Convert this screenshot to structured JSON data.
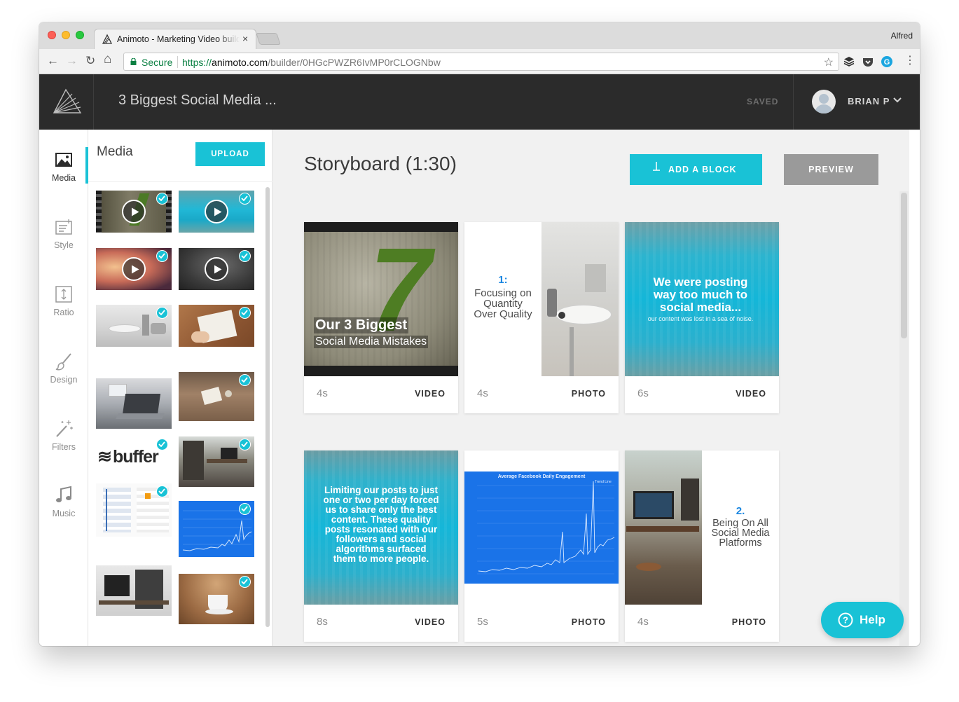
{
  "browser": {
    "tab_title": "Animoto - Marketing Video builder",
    "tab_close": "×",
    "profile_name": "Alfred",
    "secure_label": "Secure",
    "url_scheme": "https://",
    "url_host": "animoto.com",
    "url_path": "/builder/0HGcPWZR6IvMP0rCLOGNbw",
    "nav": {
      "back": "←",
      "forward": "→",
      "reload": "↻",
      "home": "⌂",
      "star": "☆",
      "menu": "⋮"
    }
  },
  "header": {
    "project_title": "3 Biggest Social Media ...",
    "save_status": "SAVED",
    "user_name": "BRIAN P"
  },
  "sidebar": {
    "items": [
      {
        "label": "Media",
        "icon": "image-icon",
        "active": true
      },
      {
        "label": "Style",
        "icon": "style-icon"
      },
      {
        "label": "Ratio",
        "icon": "ratio-icon"
      },
      {
        "label": "Design",
        "icon": "brush-icon"
      },
      {
        "label": "Filters",
        "icon": "magic-wand-icon"
      },
      {
        "label": "Music",
        "icon": "music-note-icon"
      }
    ]
  },
  "media_panel": {
    "title": "Media",
    "upload_label": "UPLOAD",
    "thumbnails": [
      {
        "kind": "video",
        "selected": true
      },
      {
        "kind": "video",
        "selected": true
      },
      {
        "kind": "video",
        "selected": true
      },
      {
        "kind": "video",
        "selected": true
      },
      {
        "kind": "photo",
        "selected": true
      },
      {
        "kind": "photo",
        "selected": true
      },
      {
        "kind": "photo",
        "selected": false
      },
      {
        "kind": "photo",
        "selected": true
      },
      {
        "kind": "logo",
        "logo_text": "buffer",
        "selected": true
      },
      {
        "kind": "photo",
        "selected": true
      },
      {
        "kind": "photo",
        "selected": true
      },
      {
        "kind": "chart",
        "selected": true
      },
      {
        "kind": "photo",
        "selected": false
      },
      {
        "kind": "photo",
        "selected": true
      }
    ]
  },
  "storyboard": {
    "title": "Storyboard (1:30)",
    "add_block_label": "ADD A BLOCK",
    "preview_label": "PREVIEW",
    "blocks": [
      {
        "duration": "4s",
        "type": "VIDEO",
        "heading": "Our 3 Biggest",
        "subheading": "Social Media Mistakes",
        "big_number": "7"
      },
      {
        "duration": "4s",
        "type": "PHOTO",
        "number": "1:",
        "lines": [
          "Focusing on",
          "Quantity",
          "Over Quality"
        ]
      },
      {
        "duration": "6s",
        "type": "VIDEO",
        "lines": [
          "We were posting",
          "way too much to",
          "social media..."
        ],
        "caption": "our content was lost in a sea of noise."
      },
      {
        "duration": "8s",
        "type": "VIDEO",
        "lines": [
          "Limiting our posts to just",
          "one or two per day forced",
          "us to share only the best",
          "content. These quality",
          "posts resonated with our",
          "followers and social",
          "algorithms surfaced",
          "them to more people."
        ]
      },
      {
        "duration": "5s",
        "type": "PHOTO",
        "chart_title": "Average Facebook Daily Engagement",
        "chart_corner": "Trend Line"
      },
      {
        "duration": "4s",
        "type": "PHOTO",
        "number": "2.",
        "lines": [
          "Being On All",
          "Social Media",
          "Platforms"
        ]
      }
    ]
  },
  "help": {
    "label": "Help"
  },
  "colors": {
    "accent": "#19c2d6",
    "header_bg": "#2b2b2b",
    "canvas_bg": "#f1f1f1",
    "preview_bg": "#9a9a9a",
    "chart_blue": "#1a73e8"
  }
}
